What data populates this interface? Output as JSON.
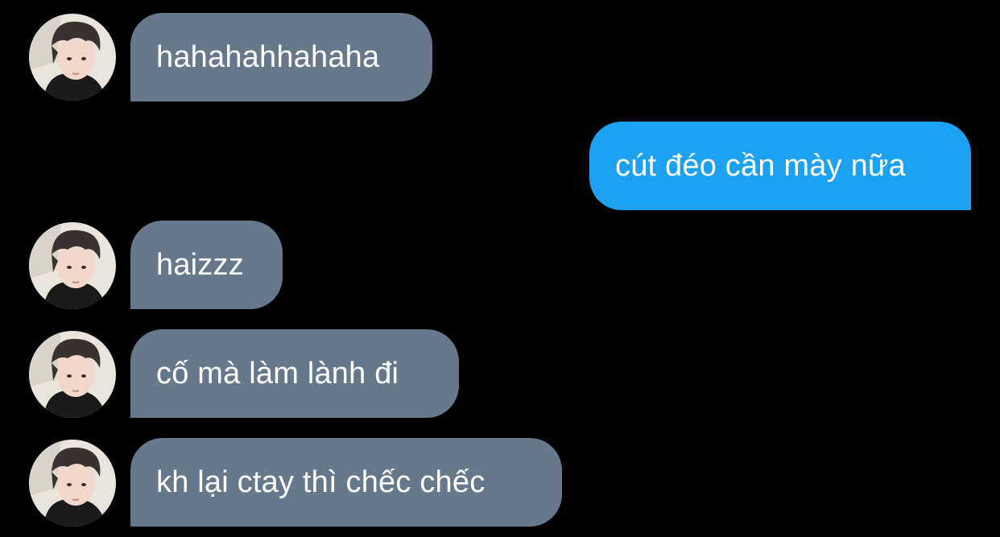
{
  "conversation": {
    "colors": {
      "background": "#000000",
      "incoming_bubble": "#66788a",
      "outgoing_bubble": "#1da1f2",
      "text": "#ffffff"
    },
    "messages": [
      {
        "direction": "incoming",
        "text": "hahahahhahaha",
        "avatar": "profile-photo"
      },
      {
        "direction": "outgoing",
        "text": "cút đéo cần mày nữa"
      },
      {
        "direction": "incoming",
        "text": "haizzz",
        "avatar": "profile-photo"
      },
      {
        "direction": "incoming",
        "text": "cố mà làm lành đi",
        "avatar": "profile-photo"
      },
      {
        "direction": "incoming",
        "text": "kh lại ctay thì chếc chếc",
        "avatar": "profile-photo"
      }
    ]
  }
}
